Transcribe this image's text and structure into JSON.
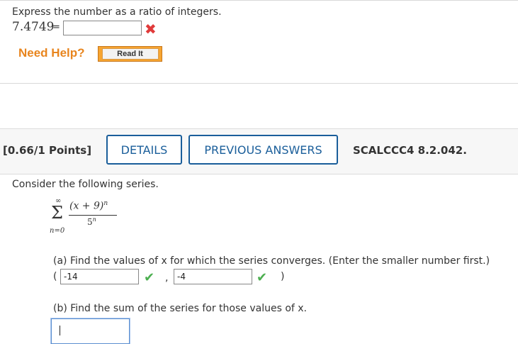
{
  "q1": {
    "prompt": "Express the number as a ratio of integers.",
    "number": "7.4749",
    "equals": "=",
    "answer_value": "",
    "status": "✖"
  },
  "help": {
    "label": "Need Help?",
    "read_it": "Read It"
  },
  "q2": {
    "points": "[0.66/1 Points]",
    "details_btn": "DETAILS",
    "previous_btn": "PREVIOUS ANSWERS",
    "code": "SCALCCC4 8.2.042.",
    "prompt": "Consider the following series.",
    "series": {
      "sigma": "Σ",
      "upper": "∞",
      "lower": "n=0",
      "numerator": "(x + 9)",
      "num_exp": "n",
      "denominator": "5",
      "den_exp": "n"
    },
    "part_a": {
      "text": "(a) Find the values of x for which the series converges. (Enter the smaller number first.)",
      "open_paren": "(",
      "value1": "-14",
      "comma": ",",
      "value2": "-4",
      "close_paren": ")",
      "status1": "✔",
      "status2": "✔"
    },
    "part_b": {
      "text": "(b) Find the sum of the series for those values of x.",
      "answer_value": ""
    }
  }
}
